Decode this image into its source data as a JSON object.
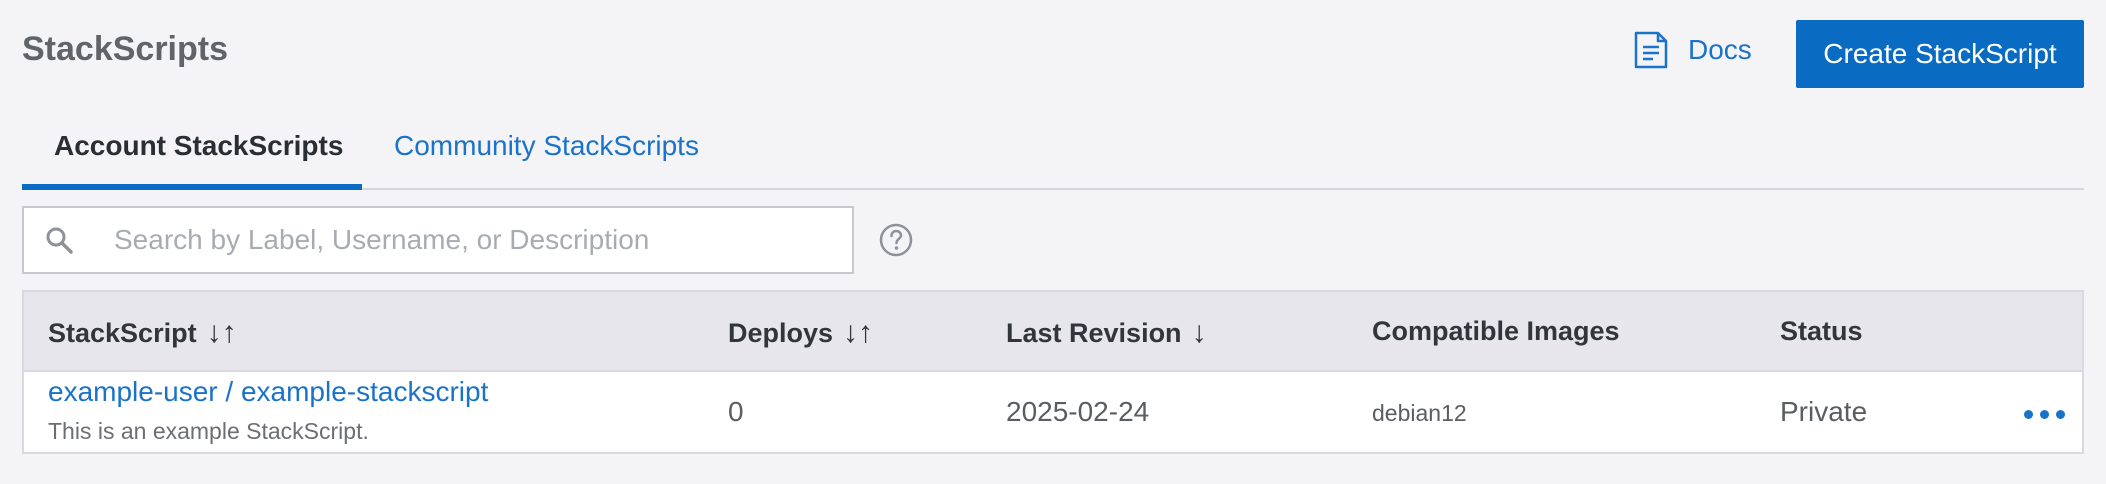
{
  "header": {
    "title": "StackScripts",
    "docs_label": "Docs",
    "create_label": "Create StackScript"
  },
  "tabs": [
    {
      "label": "Account StackScripts",
      "active": true
    },
    {
      "label": "Community StackScripts",
      "active": false
    }
  ],
  "search": {
    "placeholder": "Search by Label, Username, or Description",
    "value": ""
  },
  "table": {
    "columns": [
      {
        "label": "StackScript",
        "sort": "↓↑"
      },
      {
        "label": "Deploys",
        "sort": "↓↑"
      },
      {
        "label": "Last Revision",
        "sort": "↓"
      },
      {
        "label": "Compatible Images",
        "sort": ""
      },
      {
        "label": "Status",
        "sort": ""
      }
    ],
    "rows": [
      {
        "name": "example-user / example-stackscript",
        "description": "This is an example StackScript.",
        "deploys": "0",
        "last_revision": "2025-02-24",
        "images": "debian12",
        "status": "Private"
      }
    ]
  },
  "colors": {
    "accent": "#0a6bc2",
    "link": "#1a73c9",
    "background": "#f4f4f6",
    "header_row": "#e6e6ec"
  },
  "icons": [
    "docs-icon",
    "search-icon",
    "help-icon",
    "more-actions-icon"
  ]
}
